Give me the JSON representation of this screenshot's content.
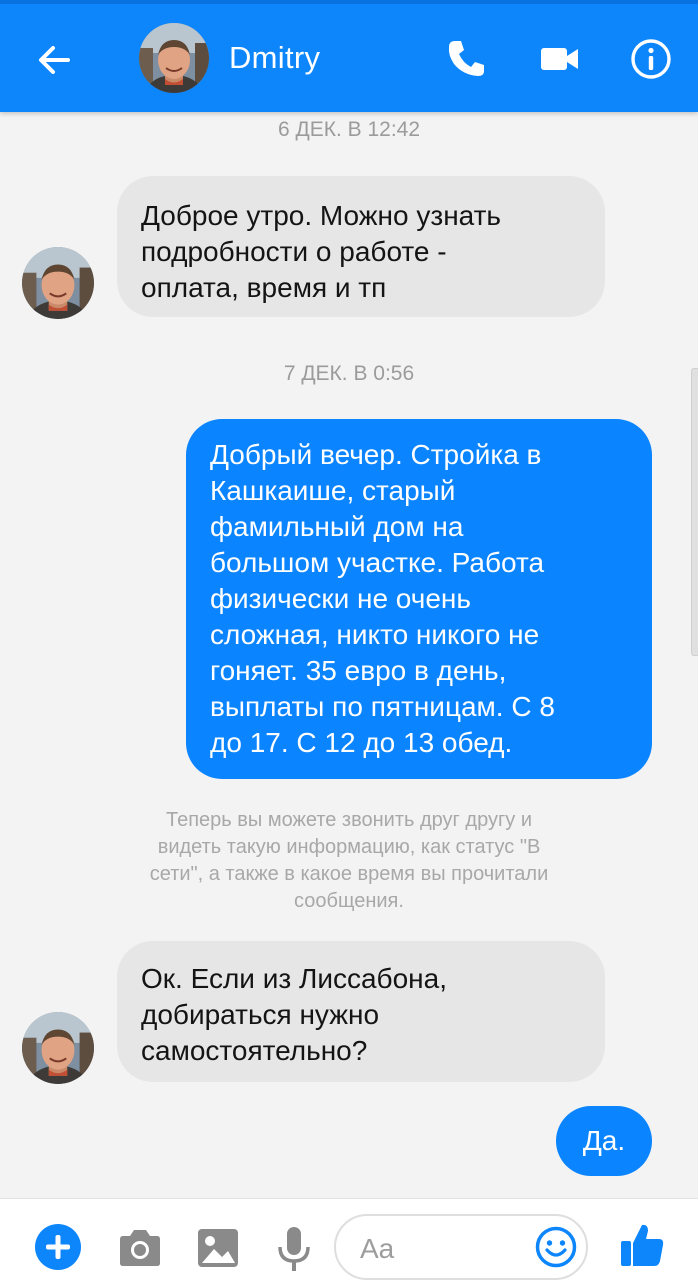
{
  "header": {
    "contact_name": "Dmitry",
    "avatar_icon": "user-avatar",
    "back_icon": "arrow-left-icon",
    "call_icon": "phone-icon",
    "video_icon": "video-camera-icon",
    "info_icon": "info-icon"
  },
  "conversation": {
    "timestamp_1": "6 ДЕК. В 12:42",
    "message_1_lines": [
      "Доброе утро. Можно узнать",
      "подробности о работе -",
      "оплата, время и тп"
    ],
    "timestamp_2": "7 ДЕК. В 0:56",
    "message_2_lines": [
      "Добрый вечер. Стройка в",
      "Кашкаише, старый",
      "фамильный дом на",
      "большом участке. Работа",
      "физически не очень",
      "сложная, никто никого не",
      "гоняет. 35 евро в день,",
      "выплаты по пятницам. С 8",
      "до 17. С 12 до 13 обед."
    ],
    "notice_lines": [
      "Теперь вы можете звонить друг другу и",
      "видеть такую информацию, как статус \"В",
      "сети\", а также в какое время вы прочитали",
      "сообщения."
    ],
    "message_3_lines": [
      "Ок. Если из Лиссабона,",
      "добираться нужно",
      "самостоятельно?"
    ],
    "message_4": "Да."
  },
  "composer": {
    "placeholder": "Aa",
    "add_icon": "plus-circle-icon",
    "camera_icon": "camera-icon",
    "gallery_icon": "image-icon",
    "mic_icon": "microphone-icon",
    "emoji_icon": "smiley-icon",
    "like_icon": "thumbs-up-icon"
  },
  "colors": {
    "brand_blue": "#0d86fb",
    "outgoing_bubble": "#0b84ff",
    "incoming_bubble": "#e6e6e6"
  }
}
